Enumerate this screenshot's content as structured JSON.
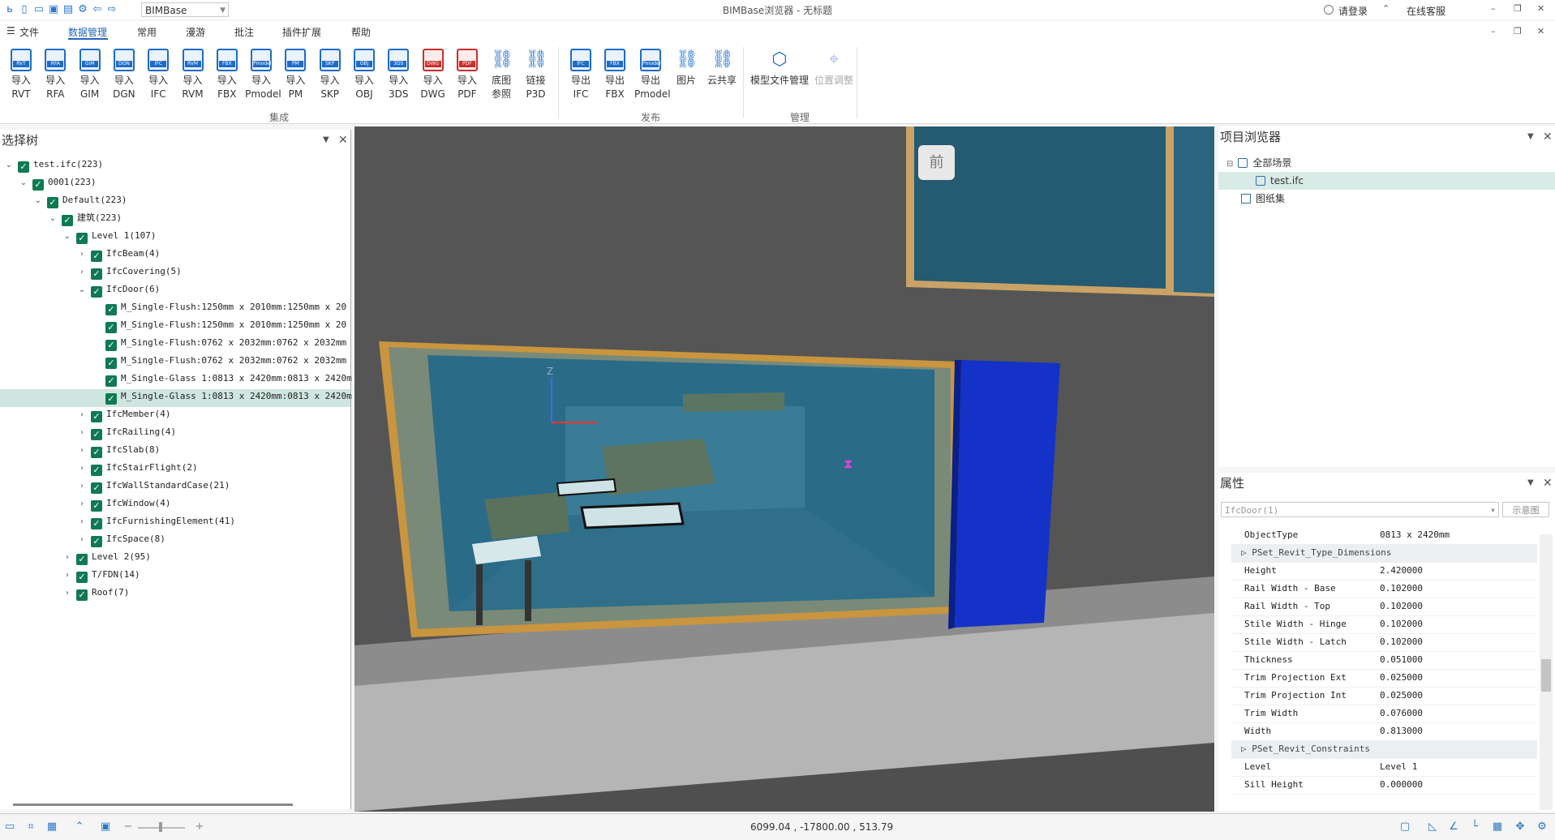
{
  "app": {
    "selector": "BIMBase",
    "title": "BIMBase浏览器 - 无标题",
    "login": "请登录",
    "support": "在线客服"
  },
  "menu": [
    "文件",
    "数据管理",
    "常用",
    "漫游",
    "批注",
    "插件扩展",
    "帮助"
  ],
  "ribbon": {
    "import_buttons": [
      {
        "top": "导入",
        "bottom": "RVT",
        "icon": "RVT"
      },
      {
        "top": "导入",
        "bottom": "RFA",
        "icon": "RFA"
      },
      {
        "top": "导入",
        "bottom": "GIM",
        "icon": "GIM"
      },
      {
        "top": "导入",
        "bottom": "DGN",
        "icon": "DGN"
      },
      {
        "top": "导入",
        "bottom": "IFC",
        "icon": "IFC"
      },
      {
        "top": "导入",
        "bottom": "RVM",
        "icon": "RVM"
      },
      {
        "top": "导入",
        "bottom": "FBX",
        "icon": "FBX"
      },
      {
        "top": "导入",
        "bottom": "Pmodel",
        "icon": "Pmodel"
      },
      {
        "top": "导入",
        "bottom": "PM",
        "icon": "PM"
      },
      {
        "top": "导入",
        "bottom": "SKP",
        "icon": "SKP"
      },
      {
        "top": "导入",
        "bottom": "OBJ",
        "icon": "OBJ"
      },
      {
        "top": "导入",
        "bottom": "3DS",
        "icon": "3DS"
      },
      {
        "top": "导入",
        "bottom": "DWG",
        "icon": "DWG"
      },
      {
        "top": "导入",
        "bottom": "PDF",
        "icon": "PDF"
      },
      {
        "top": "底图",
        "bottom": "参照",
        "icon": ""
      },
      {
        "top": "链接",
        "bottom": "P3D",
        "icon": ""
      }
    ],
    "export_buttons": [
      {
        "top": "导出",
        "bottom": "IFC",
        "icon": "IFC"
      },
      {
        "top": "导出",
        "bottom": "FBX",
        "icon": "FBX"
      },
      {
        "top": "导出",
        "bottom": "Pmodel",
        "icon": "Pmodel"
      },
      {
        "top": "图片",
        "bottom": "",
        "icon": ""
      },
      {
        "top": "云共享",
        "bottom": "",
        "icon": ""
      }
    ],
    "manage_buttons": [
      "模型文件管理",
      "位置调整"
    ],
    "groups": [
      "集成",
      "发布",
      "管理"
    ]
  },
  "tree": {
    "title": "选择树",
    "nodes": [
      {
        "label": "test.ifc(223)",
        "exp": "v"
      },
      {
        "label": "0001(223)",
        "exp": "v"
      },
      {
        "label": "Default(223)",
        "exp": "v"
      },
      {
        "label": "建筑(223)",
        "exp": "v"
      },
      {
        "label": "Level 1(107)",
        "exp": "v"
      },
      {
        "label": "IfcBeam(4)",
        "exp": ">"
      },
      {
        "label": "IfcCovering(5)",
        "exp": ">"
      },
      {
        "label": "IfcDoor(6)",
        "exp": "v"
      },
      {
        "label": "M_Single-Flush:1250mm x 2010mm:1250mm x 20",
        "exp": ""
      },
      {
        "label": "M_Single-Flush:1250mm x 2010mm:1250mm x 20",
        "exp": ""
      },
      {
        "label": "M_Single-Flush:0762 x 2032mm:0762 x 2032mm",
        "exp": ""
      },
      {
        "label": "M_Single-Flush:0762 x 2032mm:0762 x 2032mm",
        "exp": ""
      },
      {
        "label": "M_Single-Glass 1:0813 x 2420mm:0813 x 2420m",
        "exp": ""
      },
      {
        "label": "M_Single-Glass 1:0813 x 2420mm:0813 x 2420m",
        "exp": ""
      },
      {
        "label": "IfcMember(4)",
        "exp": ">"
      },
      {
        "label": "IfcRailing(4)",
        "exp": ">"
      },
      {
        "label": "IfcSlab(8)",
        "exp": ">"
      },
      {
        "label": "IfcStairFlight(2)",
        "exp": ">"
      },
      {
        "label": "IfcWallStandardCase(21)",
        "exp": ">"
      },
      {
        "label": "IfcWindow(4)",
        "exp": ">"
      },
      {
        "label": "IfcFurnishingElement(41)",
        "exp": ">"
      },
      {
        "label": "IfcSpace(8)",
        "exp": ">"
      },
      {
        "label": "Level 2(95)",
        "exp": ">"
      },
      {
        "label": "T/FDN(14)",
        "exp": ">"
      },
      {
        "label": "Roof(7)",
        "exp": ">"
      }
    ]
  },
  "viewcube": {
    "label": "前"
  },
  "project": {
    "title": "项目浏览器",
    "all_scenes": "全部场景",
    "file": "test.ifc",
    "drawings": "图纸集"
  },
  "properties": {
    "title": "属性",
    "selector": "IfcDoor(1)",
    "schematic_button": "示意图",
    "rows": [
      {
        "k": "ObjectType",
        "v": "0813 x 2420mm",
        "grp": false
      },
      {
        "k": "PSet_Revit_Type_Dimensions",
        "v": "",
        "grp": true
      },
      {
        "k": "Height",
        "v": "2.420000",
        "grp": false
      },
      {
        "k": "Rail Width - Base",
        "v": "0.102000",
        "grp": false
      },
      {
        "k": "Rail Width - Top",
        "v": "0.102000",
        "grp": false
      },
      {
        "k": "Stile Width - Hinge",
        "v": "0.102000",
        "grp": false
      },
      {
        "k": "Stile Width - Latch",
        "v": "0.102000",
        "grp": false
      },
      {
        "k": "Thickness",
        "v": "0.051000",
        "grp": false
      },
      {
        "k": "Trim Projection Ext",
        "v": "0.025000",
        "grp": false
      },
      {
        "k": "Trim Projection Int",
        "v": "0.025000",
        "grp": false
      },
      {
        "k": "Trim Width",
        "v": "0.076000",
        "grp": false
      },
      {
        "k": "Width",
        "v": "0.813000",
        "grp": false
      },
      {
        "k": "PSet_Revit_Constraints",
        "v": "",
        "grp": true
      },
      {
        "k": "Level",
        "v": "Level 1",
        "grp": false
      },
      {
        "k": "Sill Height",
        "v": "0.000000",
        "grp": false
      }
    ]
  },
  "status": {
    "coords": "6099.04 , -17800.00 , 513.79"
  },
  "colors": {
    "accent": "#1f6cc8",
    "checkbox": "#0f7a52",
    "selection": "#cfe5e0",
    "viewport": "#525252"
  }
}
